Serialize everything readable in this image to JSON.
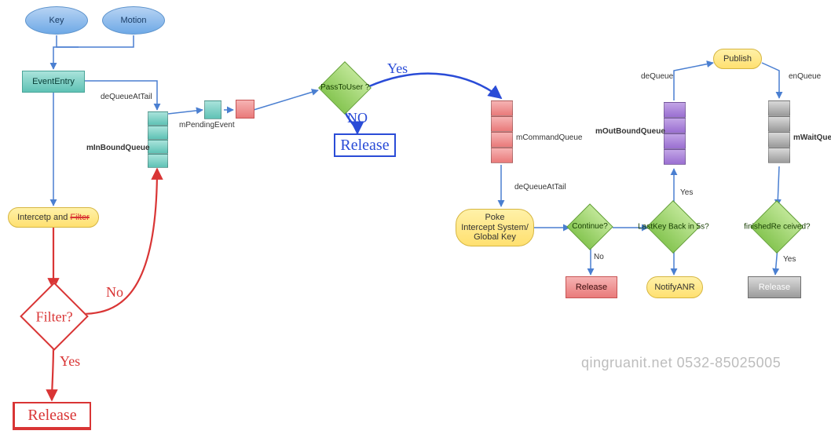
{
  "nodes": {
    "key": "Key",
    "motion": "Motion",
    "event_entry": "EventEntry",
    "intercept_filter": "Intercetp and",
    "intercept_filter_struck": "Filter",
    "filter_q": "Filter?",
    "release_hand1": "Release",
    "pass_to_user": "PassToUser\n?",
    "release_hand2": "Release",
    "poke": "Poke\nIntercept System/\nGlobal Key",
    "continue_q": "Continue?",
    "release_red": "Release",
    "lastkey": "LastKey\nBack in 5s?",
    "notify_anr": "NotifyANR",
    "publish": "Publish",
    "finished_recv": "finishedRe\nceived?",
    "release_gray": "Release"
  },
  "queues": {
    "mInBoundQueue": "mInBoundQueue",
    "mPendingEvent": "mPendingEvent",
    "mCommandQueue": "mCommandQueue",
    "mOutBoundQueue": "mOutBoundQueue",
    "mWaitQueue": "mWaitQueue"
  },
  "edge_labels": {
    "deQueueAtTail1": "deQueueAtTail",
    "yes_blue": "Yes",
    "no_blue": "NO",
    "no_hand": "No",
    "yes_hand": "Yes",
    "deQueueAtTail2": "deQueueAtTail",
    "no_cont": "No",
    "yes_lastkey": "Yes",
    "deQueue": "deQueue",
    "enQueue": "enQueue",
    "yes_finished": "Yes"
  },
  "watermark": "qingruanit.net 0532-85025005",
  "chart_data": {
    "type": "flowchart",
    "title": "",
    "nodes": [
      {
        "id": "key",
        "label": "Key",
        "shape": "oval-start",
        "color": "blue"
      },
      {
        "id": "motion",
        "label": "Motion",
        "shape": "oval-start",
        "color": "blue"
      },
      {
        "id": "evententry",
        "label": "EventEntry",
        "shape": "rect",
        "color": "teal"
      },
      {
        "id": "intercept",
        "label": "Intercetp and Filter",
        "shape": "pill",
        "color": "yellow",
        "note": "Filter is struck-through"
      },
      {
        "id": "filterq",
        "label": "Filter?",
        "shape": "diamond-hand",
        "color": "red"
      },
      {
        "id": "release1",
        "label": "Release",
        "shape": "rect-hand",
        "color": "red"
      },
      {
        "id": "mInBoundQueue",
        "label": "mInBoundQueue",
        "shape": "queue",
        "color": "teal",
        "segments": 4
      },
      {
        "id": "mPendingEvent",
        "label": "mPendingEvent",
        "shape": "queue",
        "color": "teal",
        "segments": 1
      },
      {
        "id": "redblock1",
        "label": "",
        "shape": "rect",
        "color": "red"
      },
      {
        "id": "passtouser",
        "label": "PassToUser?",
        "shape": "diamond",
        "color": "green"
      },
      {
        "id": "release2",
        "label": "Release",
        "shape": "rect-hand",
        "color": "blue"
      },
      {
        "id": "mCommandQueue",
        "label": "mCommandQueue",
        "shape": "queue",
        "color": "red",
        "segments": 4
      },
      {
        "id": "poke",
        "label": "Poke Intercept System/Global Key",
        "shape": "pill",
        "color": "yellow"
      },
      {
        "id": "continue",
        "label": "Continue?",
        "shape": "diamond",
        "color": "green"
      },
      {
        "id": "releasered",
        "label": "Release",
        "shape": "rect",
        "color": "red"
      },
      {
        "id": "lastkey",
        "label": "LastKey Back in 5s?",
        "shape": "diamond",
        "color": "green"
      },
      {
        "id": "notifyanr",
        "label": "NotifyANR",
        "shape": "pill",
        "color": "yellow"
      },
      {
        "id": "mOutBoundQueue",
        "label": "mOutBoundQueue",
        "shape": "queue",
        "color": "purple",
        "segments": 4
      },
      {
        "id": "publish",
        "label": "Publish",
        "shape": "pill",
        "color": "yellow"
      },
      {
        "id": "mWaitQueue",
        "label": "mWaitQueue",
        "shape": "queue",
        "color": "gray",
        "segments": 4
      },
      {
        "id": "finished",
        "label": "finishedReceived?",
        "shape": "diamond",
        "color": "green"
      },
      {
        "id": "releasegray",
        "label": "Release",
        "shape": "rect",
        "color": "gray"
      }
    ],
    "edges": [
      {
        "from": "key",
        "to": "evententry"
      },
      {
        "from": "motion",
        "to": "evententry"
      },
      {
        "from": "evententry",
        "to": "intercept"
      },
      {
        "from": "intercept",
        "to": "filterq",
        "style": "hand-red"
      },
      {
        "from": "filterq",
        "to": "release1",
        "label": "Yes",
        "style": "hand-red"
      },
      {
        "from": "filterq",
        "to": "mInBoundQueue",
        "label": "No",
        "style": "hand-red"
      },
      {
        "from": "mInBoundQueue",
        "to": "mPendingEvent",
        "label": "deQueueAtTail"
      },
      {
        "from": "mPendingEvent",
        "to": "redblock1"
      },
      {
        "from": "redblock1",
        "to": "passtouser"
      },
      {
        "from": "passtouser",
        "to": "release2",
        "label": "NO",
        "style": "hand-blue"
      },
      {
        "from": "passtouser",
        "to": "mCommandQueue",
        "label": "Yes",
        "style": "hand-blue"
      },
      {
        "from": "mCommandQueue",
        "to": "poke",
        "label": "deQueueAtTail"
      },
      {
        "from": "poke",
        "to": "continue"
      },
      {
        "from": "continue",
        "to": "releasered",
        "label": "No"
      },
      {
        "from": "continue",
        "to": "lastkey"
      },
      {
        "from": "lastkey",
        "to": "mOutBoundQueue",
        "label": "Yes"
      },
      {
        "from": "lastkey",
        "to": "notifyanr"
      },
      {
        "from": "mOutBoundQueue",
        "to": "publish",
        "label": "deQueue"
      },
      {
        "from": "publish",
        "to": "mWaitQueue",
        "label": "enQueue"
      },
      {
        "from": "mWaitQueue",
        "to": "finished"
      },
      {
        "from": "finished",
        "to": "releasegray",
        "label": "Yes"
      }
    ]
  }
}
